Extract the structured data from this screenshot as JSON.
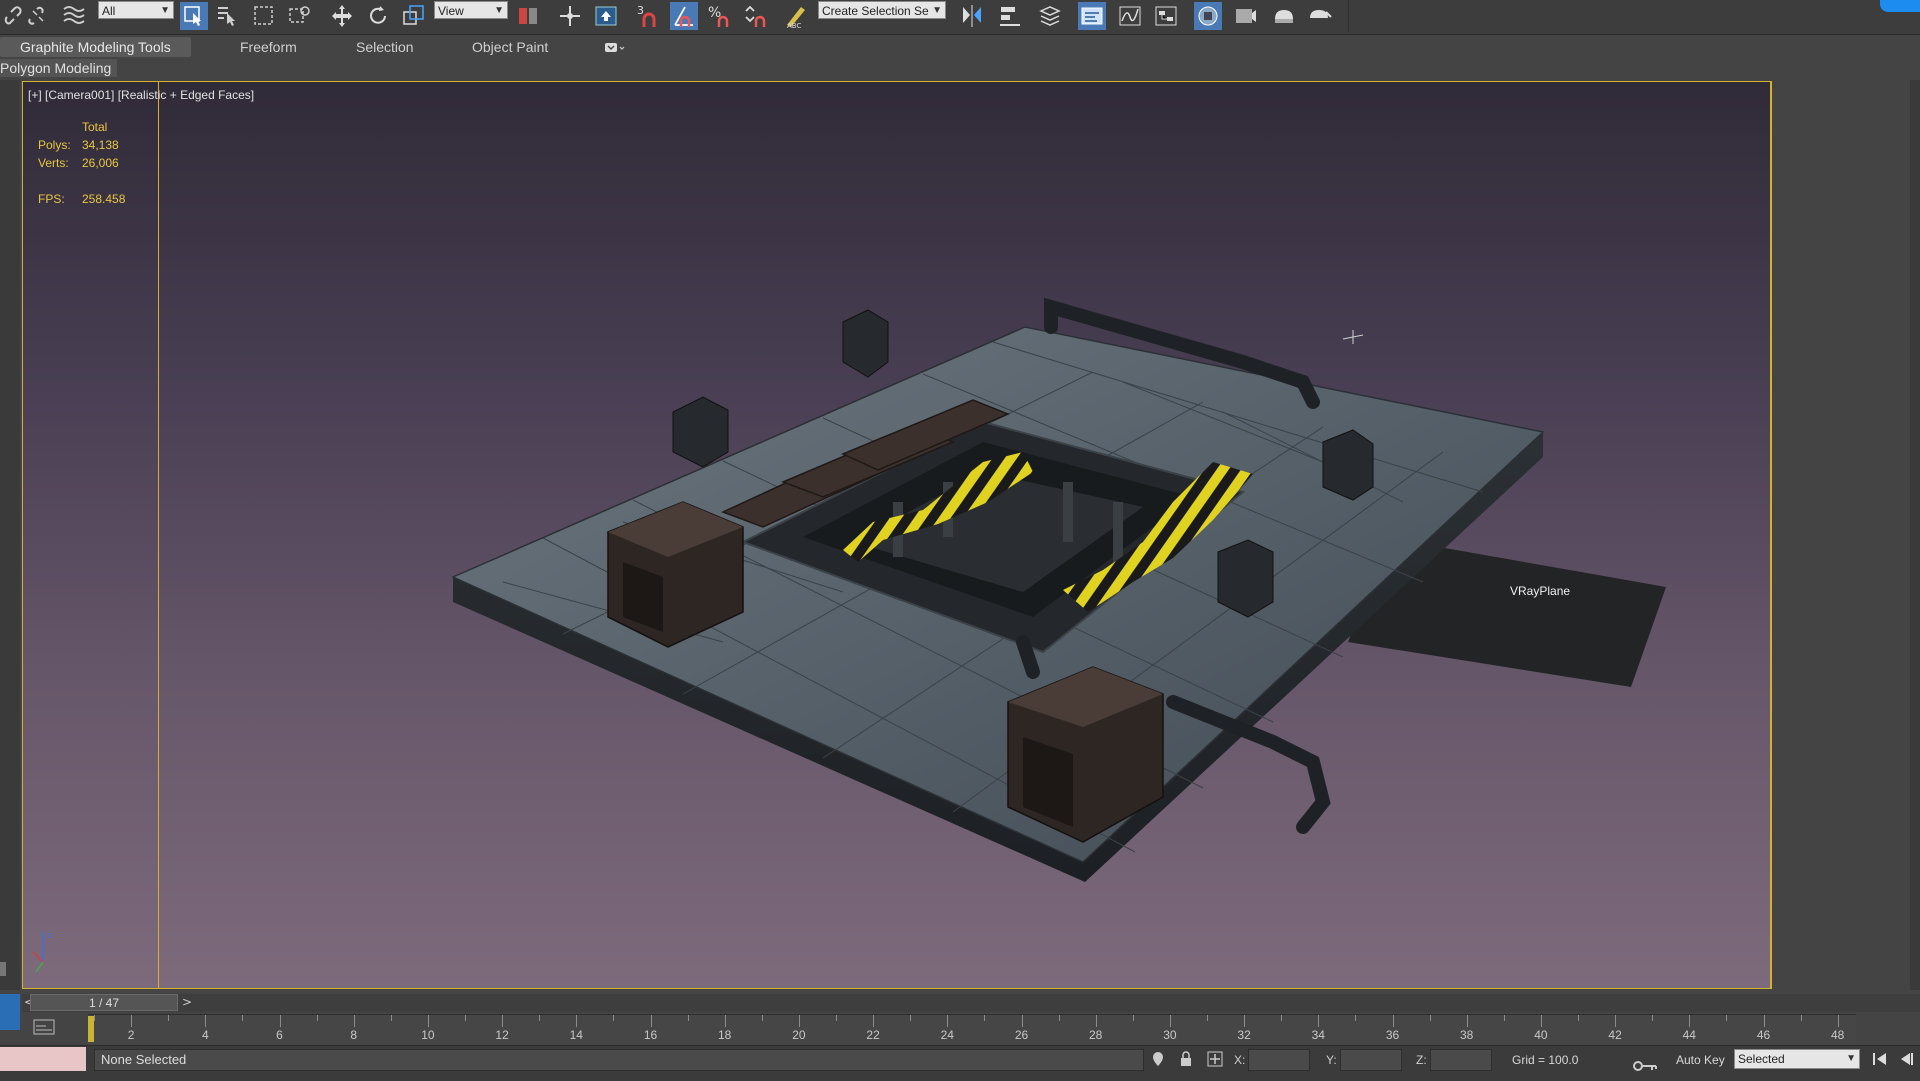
{
  "toolbar": {
    "filter_dropdown": "All",
    "view_dropdown": "View",
    "selection_set_dropdown": "Create Selection Se",
    "snap_label": "3",
    "icons": [
      "link-icon",
      "unlink-icon",
      "bind-space-warp-icon",
      "select-object-icon",
      "select-by-name-icon",
      "rectangular-selection-icon",
      "window-crossing-icon",
      "move-icon",
      "rotate-icon",
      "scale-icon",
      "pivot-icon",
      "manipulate-icon",
      "keyboard-shortcut-icon",
      "snap-toggle-icon",
      "angle-snap-icon",
      "percent-snap-icon",
      "spinner-snap-icon",
      "edit-named-selection-icon",
      "mirror-icon",
      "align-icon",
      "layer-manager-icon",
      "scene-explorer-icon",
      "curve-editor-icon",
      "schematic-view-icon",
      "material-editor-icon",
      "render-setup-icon",
      "rendered-frame-icon",
      "render-production-icon"
    ]
  },
  "ribbon": {
    "tabs": [
      "Graphite Modeling Tools",
      "Freeform",
      "Selection",
      "Object Paint"
    ],
    "panel_label": "Polygon Modeling"
  },
  "viewport": {
    "label": "[+] [Camera001] [Realistic + Edged Faces]",
    "stats": {
      "header": "Total",
      "polys_label": "Polys:",
      "polys_value": "34,138",
      "verts_label": "Verts:",
      "verts_value": "26,006",
      "fps_label": "FPS:",
      "fps_value": "258.458"
    },
    "object_label": "VRayPlane"
  },
  "timeline": {
    "frame_display": "1 / 47",
    "prev": "<",
    "next": ">",
    "ruler_labels": [
      "2",
      "4",
      "6",
      "8",
      "10",
      "12",
      "14",
      "16",
      "18",
      "20",
      "22",
      "24",
      "26",
      "28",
      "30",
      "32",
      "34",
      "36",
      "38",
      "40",
      "42",
      "44",
      "46",
      "48"
    ]
  },
  "statusbar": {
    "selection_status": "None Selected",
    "x_label": "X:",
    "y_label": "Y:",
    "z_label": "Z:",
    "grid": "Grid = 100.0",
    "auto_key": "Auto Key",
    "key_mode_dropdown": "Selected"
  },
  "colors": {
    "viewport_border": "#d6b12c",
    "stats_text": "#e8c640",
    "active_tool": "#4a7ab5"
  }
}
